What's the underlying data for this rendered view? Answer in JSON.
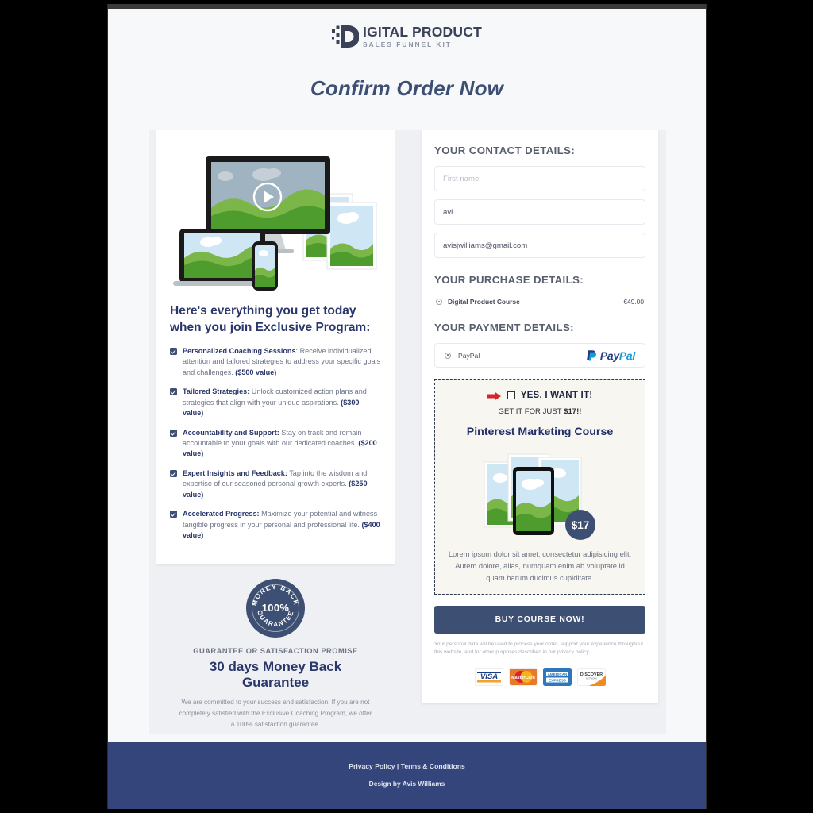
{
  "brand": {
    "logo_main": "IGITAL PRODUCT",
    "logo_letter": "D",
    "logo_sub": "SALES FUNNEL KIT"
  },
  "page_title": "Confirm Order Now",
  "left": {
    "offer_heading": "Here's everything you get today when you join Exclusive Program:",
    "benefits": [
      {
        "title": "Personalized Coaching Sessions",
        "text": ": Receive individualized attention and tailored strategies to address your specific goals and challenges. ",
        "value": "($500 value)"
      },
      {
        "title": "Tailored Strategies:",
        "text": " Unlock customized action plans and strategies that align with your unique aspirations. ",
        "value": "($300 value)"
      },
      {
        "title": "Accountability and Support:",
        "text": " Stay on track and remain accountable to your goals with our dedicated coaches. ",
        "value": "($200 value)"
      },
      {
        "title": "Expert Insights and Feedback:",
        "text": " Tap into the wisdom and expertise of our seasoned personal growth experts. ",
        "value": "($250 value)"
      },
      {
        "title": "Accelerated Progress:",
        "text": " Maximize your potential and witness tangible progress in your personal and professional life. ",
        "value": "($400 value)"
      }
    ],
    "seal": {
      "top_text": "MONEY BACK",
      "center": "100%",
      "bottom_text": "GUARANTEE"
    },
    "guarantee_kicker": "GUARANTEE OR SATISFACTION PROMISE",
    "guarantee_title": "30 days Money Back Guarantee",
    "guarantee_body": "We are committed to your success and satisfaction. If you are not completely satisfied with the Exclusive Coaching Program, we offer a 100% satisfaction guarantee."
  },
  "right": {
    "contact_title": "YOUR CONTACT DETAILS:",
    "first_name_placeholder": "First name",
    "first_name_value": "",
    "last_name_value": "avi",
    "email_value": "avisjwilliams@gmail.com",
    "purchase_title": "YOUR PURCHASE DETAILS:",
    "purchase_item": "Digital Product Course",
    "purchase_price": "€49.00",
    "payment_title": "YOUR PAYMENT DETAILS:",
    "payment_option": "PayPal",
    "paypal_pay": "Pay",
    "paypal_pal": "Pal",
    "upsell": {
      "yes_label": "YES, I WANT IT!",
      "get_it_prefix": "GET IT FOR JUST ",
      "get_it_price": "$17!!",
      "title": "Pinterest Marketing Course",
      "badge_price": "$17",
      "body": "Lorem ipsum dolor sit amet, consectetur adipisicing elit. Autem dolore, alias, numquam enim ab voluptate id quam harum ducimus cupiditate."
    },
    "buy_button": "BUY COURSE NOW!",
    "privacy_note": "Your personal data will be used to process your order, support your experience throughout this website, and for other purposes described in our privacy policy.",
    "cards": [
      "VISA",
      "MasterCard",
      "AMERICAN EXPRESS",
      "DISCOVER"
    ]
  },
  "footer": {
    "privacy_policy": "Privacy Policy",
    "separator": " | ",
    "terms": "Terms & Conditions",
    "credit": "Design by Avis Williams"
  },
  "colors": {
    "navy": "#3d4f73",
    "deep_navy": "#29376b",
    "footer": "#33457a",
    "accent_red": "#d8232a"
  }
}
